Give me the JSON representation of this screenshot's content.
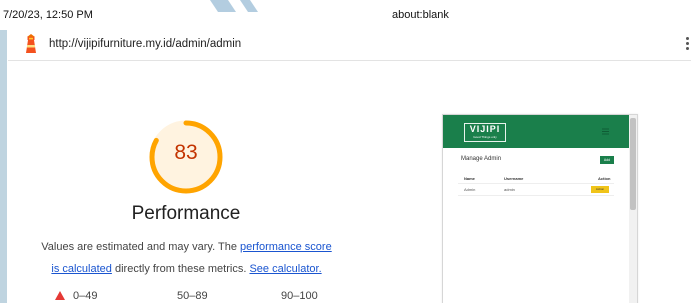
{
  "print_header": {
    "datetime": "7/20/23, 12:50 PM",
    "page_url": "about:blank"
  },
  "report": {
    "url": "http://vijipifurniture.my.id/admin/admin"
  },
  "performance": {
    "score": "83",
    "score_fraction": 0.83,
    "score_color": "#c33300",
    "ring_color": "#ffa400",
    "ring_bg": "#fff3e0",
    "title": "Performance",
    "description_pre": "Values are estimated and may vary. The ",
    "link_performance_score": "performance score",
    "link_is_calculated": "is calculated",
    "description_mid": " directly from these metrics. ",
    "link_see_calculator": "See calculator."
  },
  "legend": {
    "fail": "0–49",
    "average": "50–89",
    "pass": "90–100"
  },
  "thumbnail": {
    "brand": "VIJIPI",
    "tagline": "Good Things only",
    "heading": "Manage Admin",
    "add_button": "Add",
    "columns": [
      "Name",
      "Username",
      "Action"
    ],
    "row": [
      "Admin",
      "admin",
      "Action"
    ],
    "accent": "#1a7f4b"
  },
  "icons": {
    "lighthouse": "lighthouse-icon",
    "kebab": "kebab-menu-icon",
    "hamburger": "hamburger-icon"
  }
}
